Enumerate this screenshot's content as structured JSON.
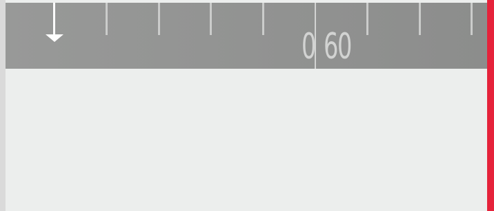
{
  "timeline": {
    "readout_left": "0",
    "readout_right": "60"
  },
  "icons": {
    "playhead_marker": "down-arrow-icon"
  },
  "colors": {
    "ruler_background": "#929392",
    "tick": "#cbcccb",
    "panel_background": "#eceeed",
    "accent": "#e5223a"
  }
}
